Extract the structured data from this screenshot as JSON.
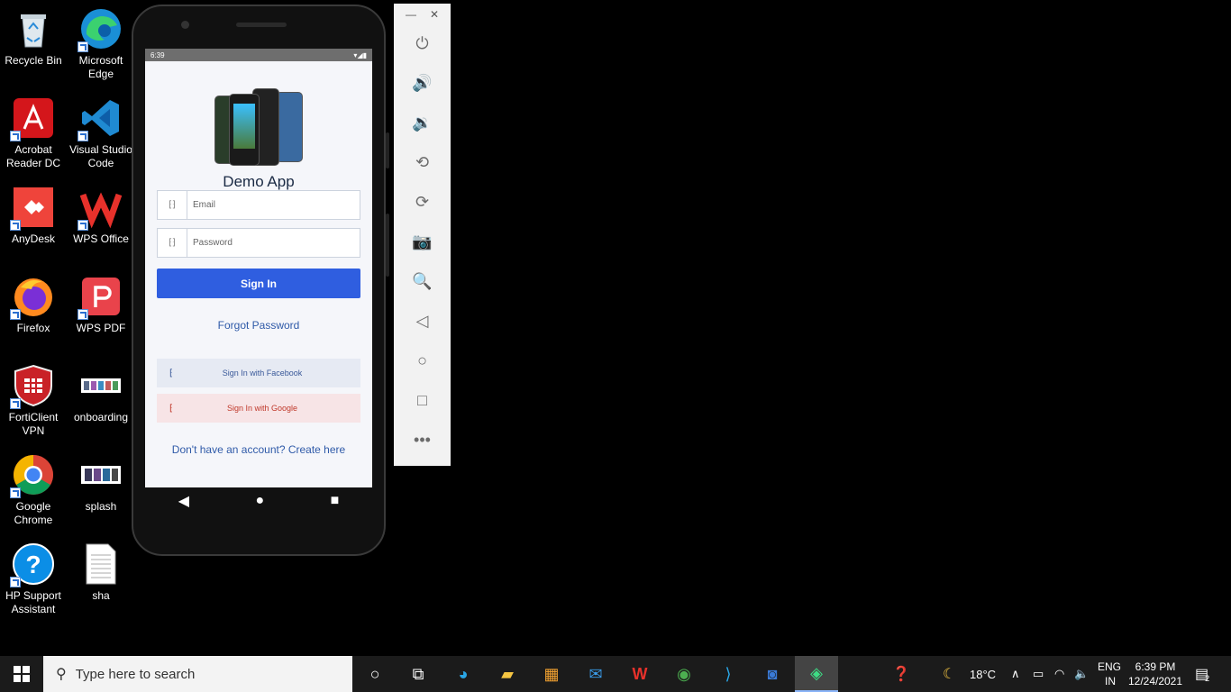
{
  "desktop": {
    "icons": [
      {
        "label": "Recycle Bin"
      },
      {
        "label": "Microsoft Edge"
      },
      {
        "label": "Acrobat Reader DC"
      },
      {
        "label": "Visual Studio Code"
      },
      {
        "label": "AnyDesk"
      },
      {
        "label": "WPS Office"
      },
      {
        "label": "Firefox"
      },
      {
        "label": "WPS PDF"
      },
      {
        "label": "FortiClient VPN"
      },
      {
        "label": "onboarding"
      },
      {
        "label": "Google Chrome"
      },
      {
        "label": "splash"
      },
      {
        "label": "HP Support Assistant"
      },
      {
        "label": "sha"
      }
    ]
  },
  "phone": {
    "status_time": "6:39",
    "app_title": "Demo App",
    "email_placeholder": "Email",
    "password_placeholder": "Password",
    "sign_in_label": "Sign In",
    "forgot_password": "Forgot Password",
    "facebook_label": "Sign In with Facebook",
    "google_label": "Sign In with Google",
    "create_account": "Don't have an account? Create here",
    "colors": {
      "primary": "#2f5ee0",
      "facebook_bg": "#e6eaf3",
      "google_bg": "#f7e4e6"
    }
  },
  "taskbar": {
    "search_placeholder": "Type here to search",
    "weather": "18°C",
    "lang_line1": "ENG",
    "lang_line2": "IN",
    "time": "6:39 PM",
    "date": "12/24/2021",
    "notification_count": "2"
  }
}
